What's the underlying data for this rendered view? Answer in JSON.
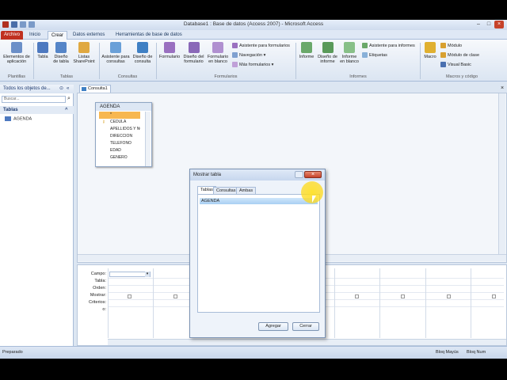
{
  "window": {
    "title": "Database1 : Base de datos (Access 2007) - Microsoft Access"
  },
  "ribbon": {
    "tabs": [
      "Archivo",
      "Inicio",
      "Crear",
      "Datos externos",
      "Herramientas de base de datos"
    ],
    "buttons": {
      "elementos": "Elementos de aplicación",
      "tabla": "Tabla",
      "diseno_tabla": "Diseño de tabla",
      "listas": "Listas SharePoint",
      "asistente_consultas": "Asistente para consultas",
      "diseno_consulta": "Diseño de consulta",
      "formulario": "Formulario",
      "diseno_formulario": "Diseño del formulario",
      "formulario_blanco": "Formulario en blanco",
      "asistente_formularios": "Asistente para formularios",
      "navegacion": "Navegación",
      "mas_formularios": "Más formularios",
      "informe": "Informe",
      "diseno_informe": "Diseño de informe",
      "informe_blanco": "Informe en blanco",
      "asistente_informes": "Asistente para informes",
      "etiquetas": "Etiquetas",
      "macro": "Macro",
      "modulo": "Módulo",
      "modulo_clase": "Módulo de clase",
      "visual_basic": "Visual Basic"
    },
    "groups": [
      "Plantillas",
      "Tablas",
      "Consultas",
      "Formularios",
      "Informes",
      "Macros y código"
    ]
  },
  "nav": {
    "header": "Todos los objetos de...",
    "search_placeholder": "Buscar...",
    "category": "Tablas",
    "items": [
      "AGENDA"
    ]
  },
  "document": {
    "tab": "Consulta1"
  },
  "table_box": {
    "title": "AGENDA",
    "fields": [
      "*",
      "CEDULA",
      "APELLIDOS Y NO",
      "DIRECCION",
      "TELEFONO",
      "EDAD",
      "GENERO"
    ]
  },
  "grid": {
    "row_labels": [
      "Campo:",
      "Tabla:",
      "Orden:",
      "Mostrar:",
      "Criterios:",
      "o:"
    ]
  },
  "dialog": {
    "title": "Mostrar tabla",
    "tabs": [
      "Tablas",
      "Consultas",
      "Ambas"
    ],
    "items": [
      "AGENDA"
    ],
    "add_label": "Agregar",
    "close_label": "Cerrar"
  },
  "status": {
    "left": "Preparado",
    "bloq_mayus": "Bloq Mayús",
    "bloq_num": "Bloq Num"
  }
}
